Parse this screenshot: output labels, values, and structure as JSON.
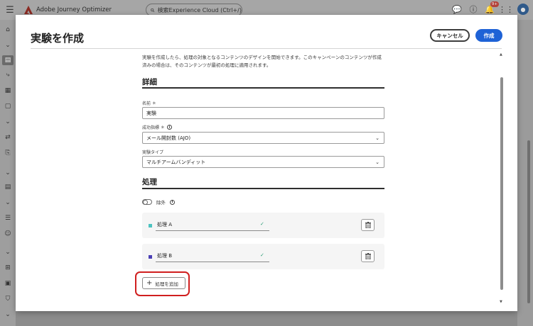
{
  "topbar": {
    "app_name": "Adobe Journey Optimizer",
    "search_placeholder": "検索Experience Cloud (Ctrl+/)",
    "notification_badge": "9+"
  },
  "modal": {
    "title": "実験を作成",
    "cancel_label": "キャンセル",
    "create_label": "作成",
    "description": "実験を作成したら、処理の対象となるコンテンツのデザインを開始できます。このキャンペーンのコンテンツが作成済みの場合は、そのコンテンツが最初の処理に適用されます。"
  },
  "details": {
    "section_title": "詳細",
    "name_label": "名前 ＊",
    "name_value": "実験",
    "metric_label": "成功指標 ＊",
    "metric_value": "メール開封数 (AJO)",
    "type_label": "実験タイプ",
    "type_value": "マルチアームバンディット"
  },
  "treatments": {
    "section_title": "処理",
    "exclude_label": "除外",
    "items": [
      {
        "label": "処理 A",
        "color": "#4cc3c0"
      },
      {
        "label": "処理 B",
        "color": "#4a3fb5"
      }
    ],
    "add_label": "処理を追加"
  },
  "colors": {
    "primary": "#1e62d6",
    "highlight": "#d01f1f",
    "success": "#2d9d78"
  }
}
